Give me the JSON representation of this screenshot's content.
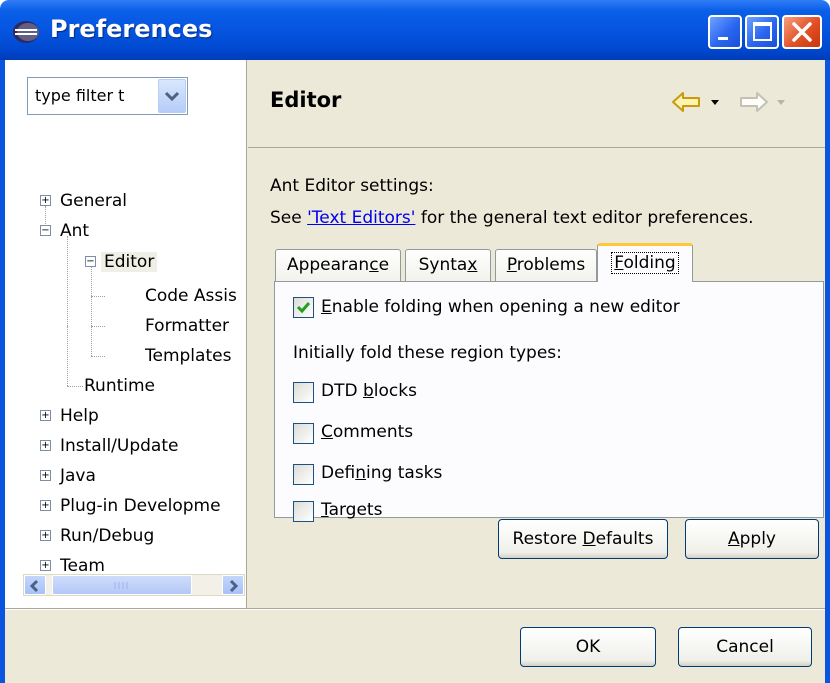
{
  "window": {
    "title": "Preferences",
    "colors": {
      "titlebar": "#0555e0",
      "body": "#ece9d8",
      "close": "#e25025",
      "tab_highlight": "#ffc83c",
      "link": "#0000ee",
      "check": "#21a121"
    }
  },
  "filter": {
    "value": "type filter t"
  },
  "tree": [
    {
      "label": "General"
    },
    {
      "label": "Ant"
    },
    {
      "label": "Editor"
    },
    {
      "label": "Code Assis"
    },
    {
      "label": "Formatter"
    },
    {
      "label": "Templates"
    },
    {
      "label": "Runtime"
    },
    {
      "label": "Help"
    },
    {
      "label": "Install/Update"
    },
    {
      "label": "Java"
    },
    {
      "label": "Plug-in Developme"
    },
    {
      "label": "Run/Debug"
    },
    {
      "label": "Team"
    }
  ],
  "page": {
    "title": "Editor",
    "settings_label": "Ant Editor settings:",
    "see_prefix": "See ",
    "see_link": "'Text Editors'",
    "see_suffix": " for the general text editor preferences."
  },
  "tabs": [
    {
      "pre": "Appearan",
      "key": "c",
      "post": "e"
    },
    {
      "pre": "Synta",
      "key": "x",
      "post": ""
    },
    {
      "pre": "",
      "key": "P",
      "post": "roblems"
    },
    {
      "pre": "",
      "key": "F",
      "post": "olding"
    }
  ],
  "folding": {
    "enable": {
      "pre": "",
      "key": "E",
      "post": "nable folding when opening a new editor",
      "checked": true
    },
    "region_label": "Initially fold these region types:",
    "regions": [
      {
        "pre": "DTD ",
        "key": "b",
        "post": "locks",
        "checked": false
      },
      {
        "pre": "",
        "key": "C",
        "post": "omments",
        "checked": false
      },
      {
        "pre": "Defi",
        "key": "n",
        "post": "ing tasks",
        "checked": false
      },
      {
        "pre": "",
        "key": "T",
        "post": "argets",
        "checked": false
      }
    ]
  },
  "buttons": {
    "restore": {
      "pre": "Restore ",
      "key": "D",
      "post": "efaults"
    },
    "apply": {
      "pre": "",
      "key": "A",
      "post": "pply"
    },
    "ok": "OK",
    "cancel": "Cancel"
  },
  "icons": {
    "app": "eclipse-icon",
    "back": "back-arrow-icon",
    "forward": "forward-arrow-icon",
    "minimize": "minimize-icon",
    "maximize": "maximize-icon",
    "close": "close-icon"
  }
}
